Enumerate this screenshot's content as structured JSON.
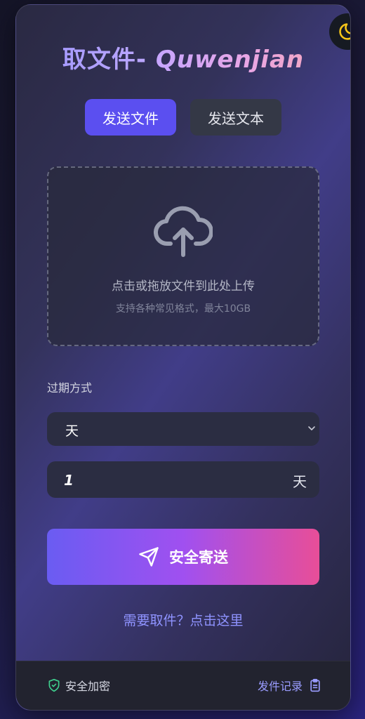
{
  "app": {
    "title_cjk": "取文件-",
    "title_latin": "Quwenjian"
  },
  "tabs": [
    {
      "label": "发送文件",
      "active": true
    },
    {
      "label": "发送文本",
      "active": false
    }
  ],
  "upload": {
    "main_text": "点击或拖放文件到此处上传",
    "sub_text": "支持各种常见格式，最大10GB",
    "icon": "cloud-upload-icon"
  },
  "expiration": {
    "label": "过期方式",
    "selected": "天",
    "amount": "1",
    "unit": "天"
  },
  "actions": {
    "submit_label": "安全寄送",
    "retrieve_link": "需要取件？点击这里"
  },
  "footer": {
    "secure_label": "安全加密",
    "history_label": "发件记录"
  },
  "colors": {
    "accent": "#5b4ff0",
    "link": "#8f93ff",
    "moon": "#f5c518",
    "shield": "#3fcf8e",
    "gradient_start": "#6a5cf2",
    "gradient_end": "#e84e98"
  }
}
